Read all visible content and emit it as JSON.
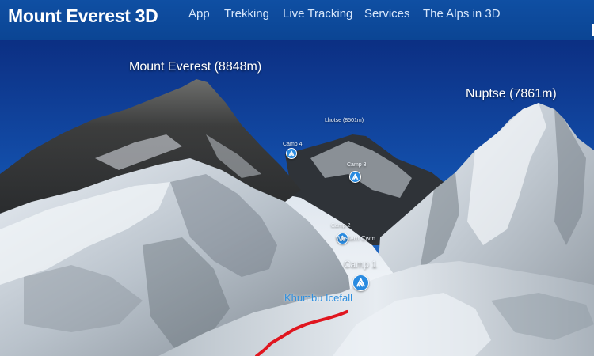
{
  "brand": "Mount Everest 3D",
  "nav": [
    {
      "label": "App"
    },
    {
      "label": "Trekking"
    },
    {
      "label": "Live Tracking"
    },
    {
      "label": "Services"
    },
    {
      "label": "The Alps in 3D"
    }
  ],
  "map": {
    "peaks": {
      "everest": "Mount Everest (8848m)",
      "nuptse": "Nuptse (7861m)",
      "lhotse": "Lhotse (8501m)"
    },
    "camps": {
      "camp4": "Camp 4",
      "camp3": "Camp 3",
      "camp2": "Camp 2",
      "western_cwm": "Western Cwm",
      "camp1": "Camp 1"
    },
    "features": {
      "icefall": "Khumbu Icefall"
    },
    "icons": {
      "camp": "tent-icon"
    },
    "colors": {
      "route": "#e0161f",
      "camp_marker": "#2a8be0",
      "navbar": "#0f4fa3"
    }
  }
}
